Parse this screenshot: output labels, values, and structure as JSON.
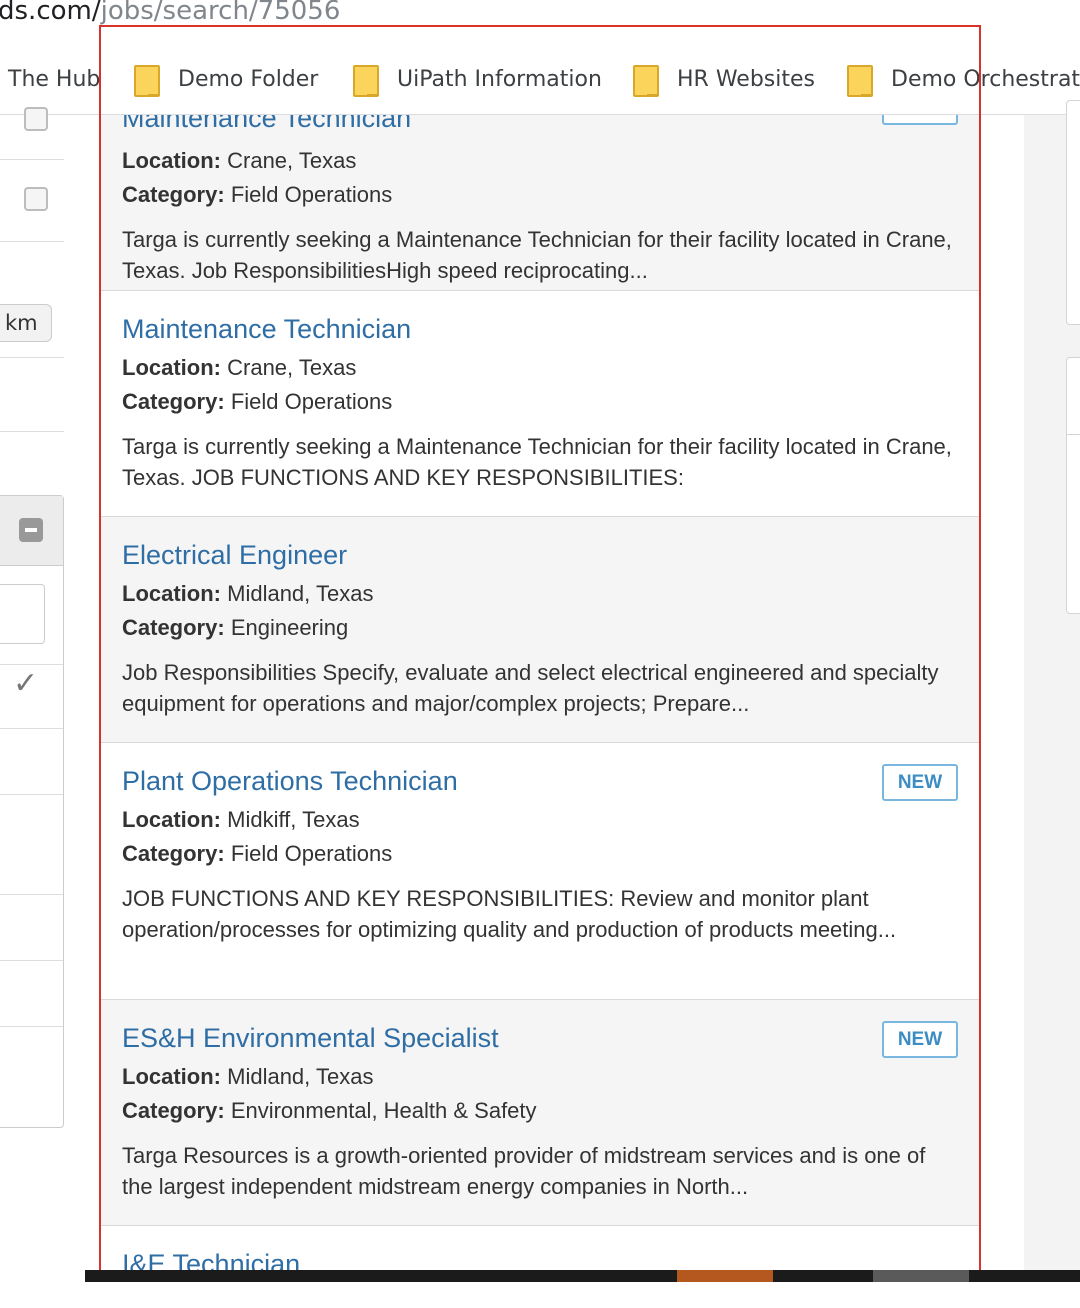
{
  "browser": {
    "url_host": "ds.com/",
    "url_path": "jobs/search/75056",
    "bookmarks": [
      {
        "label": "The Hub",
        "icon": "folder-icon"
      },
      {
        "label": "Demo Folder",
        "icon": "folder-icon"
      },
      {
        "label": "UiPath Information",
        "icon": "folder-icon"
      },
      {
        "label": "HR Websites",
        "icon": "folder-icon"
      },
      {
        "label": "Demo Orchestrato",
        "icon": "folder-icon"
      }
    ]
  },
  "filters": {
    "distance_unit": "km",
    "check_glyph": "✓"
  },
  "labels": {
    "location": "Location:",
    "category": "Category:",
    "new_badge": "NEW"
  },
  "jobs": [
    {
      "title": "Maintenance Technician",
      "location": "Crane, Texas",
      "category": "Field Operations",
      "description": "Targa is currently seeking a Maintenance Technician for their facility located in Crane, Texas. Job ResponsibilitiesHigh speed reciprocating...",
      "is_new": true
    },
    {
      "title": "Maintenance Technician",
      "location": "Crane, Texas",
      "category": "Field Operations",
      "description": "Targa is currently seeking a Maintenance Technician for their facility located in Crane, Texas. JOB FUNCTIONS AND KEY RESPONSIBILITIES:",
      "is_new": false
    },
    {
      "title": "Electrical Engineer",
      "location": "Midland, Texas",
      "category": "Engineering",
      "description": "Job Responsibilities Specify, evaluate and select electrical engineered and specialty equipment for operations and major/complex projects; Prepare...",
      "is_new": false
    },
    {
      "title": "Plant Operations Technician",
      "location": "Midkiff, Texas",
      "category": "Field Operations",
      "description": "JOB FUNCTIONS AND KEY RESPONSIBILITIES: Review and monitor plant operation/processes for optimizing quality and production of products meeting...",
      "is_new": true
    },
    {
      "title": "ES&H Environmental Specialist",
      "location": "Midland, Texas",
      "category": "Environmental, Health & Safety",
      "description": "Targa Resources is a growth-oriented provider of midstream services and is one of the largest independent midstream energy companies in North...",
      "is_new": true
    },
    {
      "title": "I&E Technician",
      "location": "",
      "category": "",
      "description": "",
      "is_new": false
    }
  ],
  "colors": {
    "job_title": "#2f6ea5",
    "badge_border": "#79b7de",
    "selection_frame": "#d9322b"
  }
}
